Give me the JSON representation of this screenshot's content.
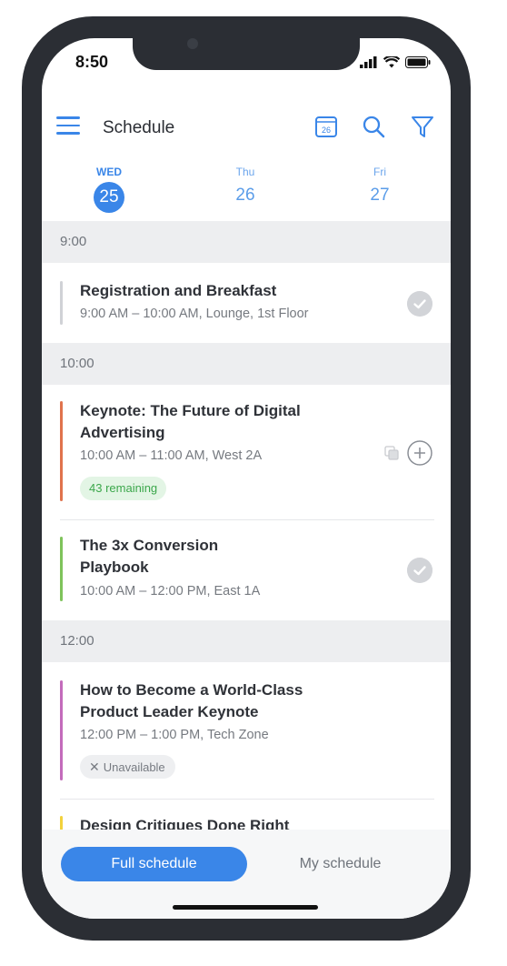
{
  "status_bar": {
    "time": "8:50"
  },
  "header": {
    "title": "Schedule",
    "calendar_badge": "26",
    "icons": [
      "menu-icon",
      "calendar-icon",
      "search-icon",
      "filter-icon"
    ]
  },
  "day_tabs": [
    {
      "day": "WED",
      "date": "25",
      "active": true
    },
    {
      "day": "Thu",
      "date": "26",
      "active": false
    },
    {
      "day": "Fri",
      "date": "27",
      "active": false
    }
  ],
  "time_slots": [
    "9:00",
    "10:00",
    "12:00"
  ],
  "sessions": [
    {
      "title": "Registration and Breakfast",
      "meta": "9:00 AM – 10:00 AM, Lounge, 1st Floor",
      "color": "#d0d2d6"
    },
    {
      "title": "Keynote: The Future of Digital Advertising",
      "meta": "10:00 AM – 11:00 AM, West 2A",
      "badge": "43 remaining",
      "color": "#e0734d"
    },
    {
      "title": "The 3x Conversion Playbook",
      "meta": "10:00 AM – 12:00 PM, East 1A",
      "color": "#7fc35b"
    },
    {
      "title": "How to Become a World-Class Product Leader Keynote",
      "meta": "12:00 PM – 1:00 PM, Tech Zone",
      "badge": "Unavailable",
      "color": "#c36bbb"
    },
    {
      "title": "Design Critiques Done Right",
      "color": "#f2d23c"
    }
  ],
  "bottom_tabs": {
    "full": "Full schedule",
    "mine": "My schedule"
  },
  "colors": {
    "accent": "#3a86e8"
  }
}
